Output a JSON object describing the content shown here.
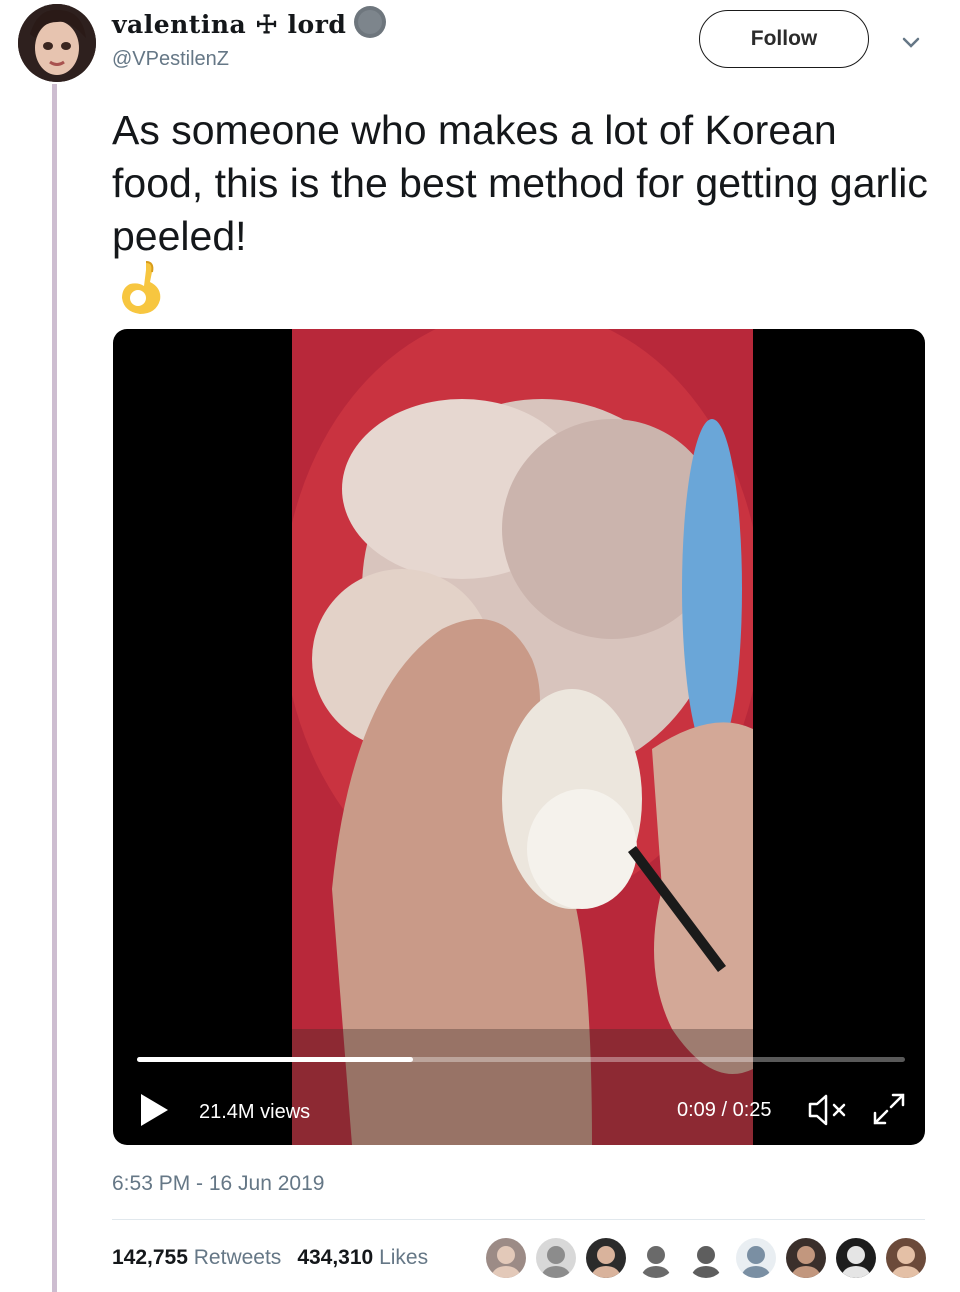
{
  "author": {
    "display_name": "valentina ☩ lord",
    "handle": "@VPestilenZ"
  },
  "actions": {
    "follow_label": "Follow"
  },
  "tweet": {
    "text": "As someone who makes a lot of Korean food, this is the best method for getting garlic peeled!",
    "emoji_icon": "ok-hand-icon",
    "timestamp": "6:53 PM - 16 Jun 2019"
  },
  "video": {
    "views": "21.4M views",
    "time": "0:09 / 0:25",
    "progress_fraction": 0.36
  },
  "stats": {
    "retweets_count": "142,755",
    "retweets_label": "Retweets",
    "likes_count": "434,310",
    "likes_label": "Likes"
  },
  "likers": [
    {
      "icon": "liker-avatar"
    },
    {
      "icon": "liker-avatar"
    },
    {
      "icon": "liker-avatar"
    },
    {
      "icon": "liker-avatar"
    },
    {
      "icon": "liker-avatar"
    },
    {
      "icon": "liker-avatar"
    },
    {
      "icon": "liker-avatar"
    },
    {
      "icon": "liker-avatar"
    },
    {
      "icon": "liker-avatar"
    }
  ],
  "colors": {
    "thread_line": "#cdbdd0",
    "secondary_text": "#657786",
    "video_bg": "#000000"
  }
}
